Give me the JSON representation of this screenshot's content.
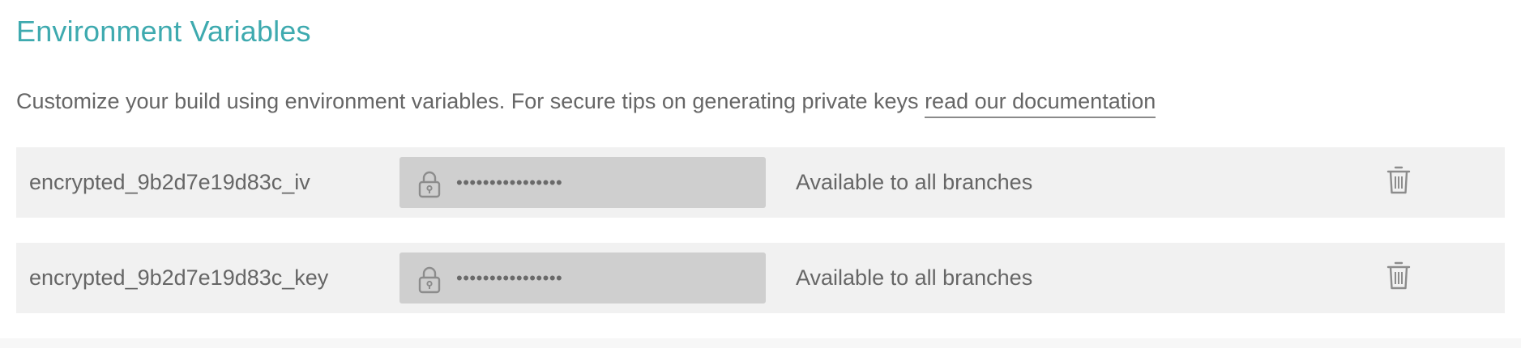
{
  "section": {
    "title": "Environment Variables",
    "description_prefix": "Customize your build using environment variables. For secure tips on generating private keys ",
    "description_link": "read our documentation"
  },
  "variables": [
    {
      "name": "encrypted_9b2d7e19d83c_iv",
      "masked_value": "••••••••••••••••",
      "availability": "Available to all branches",
      "lock_icon": "lock-icon",
      "delete_icon": "trash-icon"
    },
    {
      "name": "encrypted_9b2d7e19d83c_key",
      "masked_value": "••••••••••••••••",
      "availability": "Available to all branches",
      "lock_icon": "lock-icon",
      "delete_icon": "trash-icon"
    }
  ],
  "colors": {
    "title": "#3eaaaf",
    "text": "#666666",
    "row_bg": "#f1f1f1",
    "value_bg": "#cfcfcf"
  }
}
